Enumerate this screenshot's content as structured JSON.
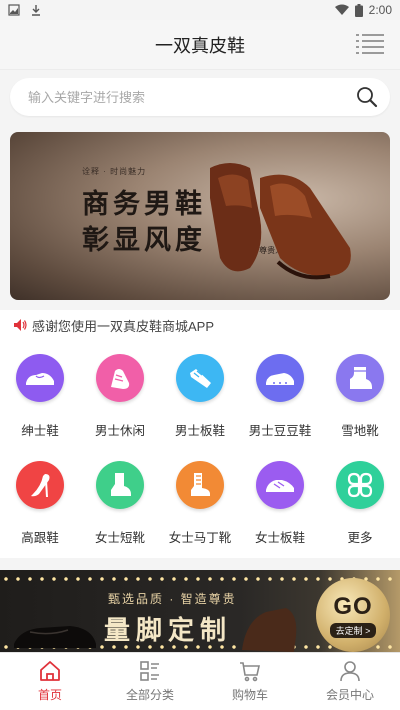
{
  "status": {
    "time": "2:00"
  },
  "header": {
    "title": "一双真皮鞋"
  },
  "search": {
    "placeholder": "输入关键字进行搜索"
  },
  "banner": {
    "tagline": "诠释 · 时尚魅力",
    "headline1": "商务男鞋",
    "headline2": "彰显风度",
    "subline": "演绎 · 尊贵人生"
  },
  "notice": {
    "text": "感谢您使用一双真皮鞋商城APP"
  },
  "categories": [
    {
      "label": "绅士鞋",
      "color": "#8e5bf0",
      "icon": "loafer-icon"
    },
    {
      "label": "男士休闲",
      "color": "#f15fa8",
      "icon": "sneaker-icon"
    },
    {
      "label": "男士板鞋",
      "color": "#3db7f3",
      "icon": "skate-shoe-icon"
    },
    {
      "label": "男士豆豆鞋",
      "color": "#6d6df0",
      "icon": "driving-shoe-icon"
    },
    {
      "label": "雪地靴",
      "color": "#8a78ef",
      "icon": "snow-boot-icon"
    },
    {
      "label": "高跟鞋",
      "color": "#f04444",
      "icon": "high-heel-icon"
    },
    {
      "label": "女士短靴",
      "color": "#3fcf8a",
      "icon": "ankle-boot-icon"
    },
    {
      "label": "女士马丁靴",
      "color": "#f28a35",
      "icon": "martin-boot-icon"
    },
    {
      "label": "女士板鞋",
      "color": "#9b5cf0",
      "icon": "womens-sneaker-icon"
    },
    {
      "label": "更多",
      "color": "#2fd09a",
      "icon": "more-grid-icon"
    }
  ],
  "promo": {
    "small": "甄选品质 · 智造尊贵",
    "big": "量脚定制",
    "go": "GO",
    "go_sub": "去定制 >"
  },
  "tabs": [
    {
      "label": "首页",
      "icon": "home-icon",
      "active": true
    },
    {
      "label": "全部分类",
      "icon": "category-icon",
      "active": false
    },
    {
      "label": "购物车",
      "icon": "cart-icon",
      "active": false
    },
    {
      "label": "会员中心",
      "icon": "user-icon",
      "active": false
    }
  ],
  "colors": {
    "accent": "#e0323a",
    "background": "#f4f4f4"
  }
}
